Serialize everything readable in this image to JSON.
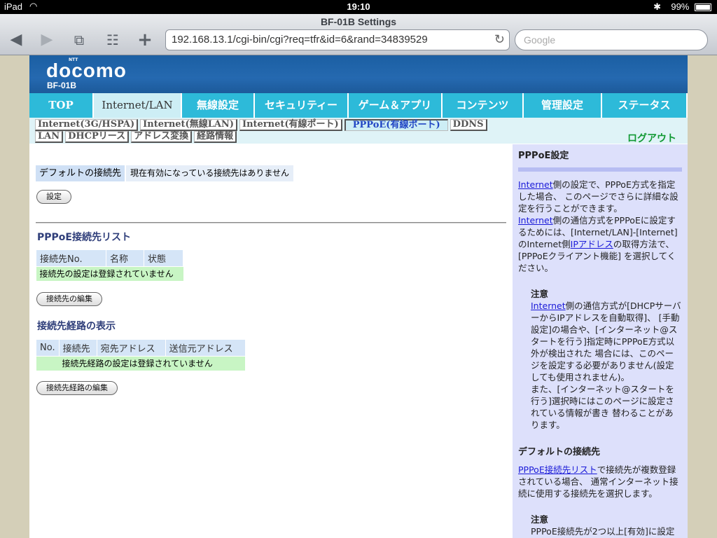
{
  "status": {
    "device": "iPad",
    "time": "19:10",
    "battery": "99%",
    "battery_level": 0.99
  },
  "browser": {
    "title": "BF-01B Settings",
    "url": "192.168.13.1/cgi-bin/cgi?req=tfr&id=6&rand=34839529",
    "search_placeholder": "Google"
  },
  "brand": {
    "ntt": "NTT",
    "logo": "docomo",
    "model": "BF-01B"
  },
  "main_tabs": [
    "TOP",
    "Internet/LAN",
    "無線設定",
    "セキュリティー",
    "ゲーム＆アプリ",
    "コンテンツ",
    "管理設定",
    "ステータス"
  ],
  "sub_tabs_row1": [
    "Internet(3G/HSPA)",
    "Internet(無線LAN)",
    "Internet(有線ポート)",
    "PPPoE(有線ポート)",
    "DDNS"
  ],
  "sub_tabs_row2": [
    "LAN",
    "DHCPリース",
    "アドレス変換",
    "経路情報"
  ],
  "logout": "ログアウト",
  "main": {
    "default_label": "デフォルトの接続先",
    "default_value": "現在有効になっている接続先はありません",
    "set_button": "設定",
    "list_title": "PPPoE接続先リスト",
    "list_headers": [
      "接続先No.",
      "名称",
      "状態"
    ],
    "list_empty": "接続先の設定は登録されていません",
    "edit_button": "接続先の編集",
    "route_title": "接続先経路の表示",
    "route_headers": [
      "No.",
      "接続先",
      "宛先アドレス",
      "送信元アドレス"
    ],
    "route_empty": "接続先経路の設定は登録されていません",
    "route_edit_button": "接続先経路の編集"
  },
  "help": {
    "title": "PPPoE設定",
    "p1_link": "Internet",
    "p1_text": "側の設定で、PPPoE方式を指定した場合、 このページでさらに詳細な設定を行うことができます。",
    "p2_link": "Internet",
    "p2_text_a": "側の通信方式をPPPoEに設定するためには、[Internet/LAN]-[Internet]のInternet側",
    "p2_link2": "IPアドレス",
    "p2_text_b": "の取得方法で、[PPPoEクライアント機能] を選択してください。",
    "note1_label": "注意",
    "note1_link": "Internet",
    "note1_text": "側の通信方式が[DHCPサーバーからIPアドレスを自動取得]、 [手動設定]の場合や、[インターネット@スタートを行う]指定時にPPPoE方式以外が検出された 場合には、このページを設定する必要がありません(設定しても使用されません)。",
    "note1_text2": "また、[インターネット@スタートを行う]選択時にはこのページに設定されている情報が書き 替わることがあります。",
    "sec2_title": "デフォルトの接続先",
    "sec2_link": "PPPoE接続先リスト",
    "sec2_text": "で接続先が複数登録されている場合、 通常インターネット接続に使用する接続先を選択します。",
    "note2_label": "注意",
    "note2_text": "PPPoE接続先が2つ以上[有効]に設定さ"
  }
}
